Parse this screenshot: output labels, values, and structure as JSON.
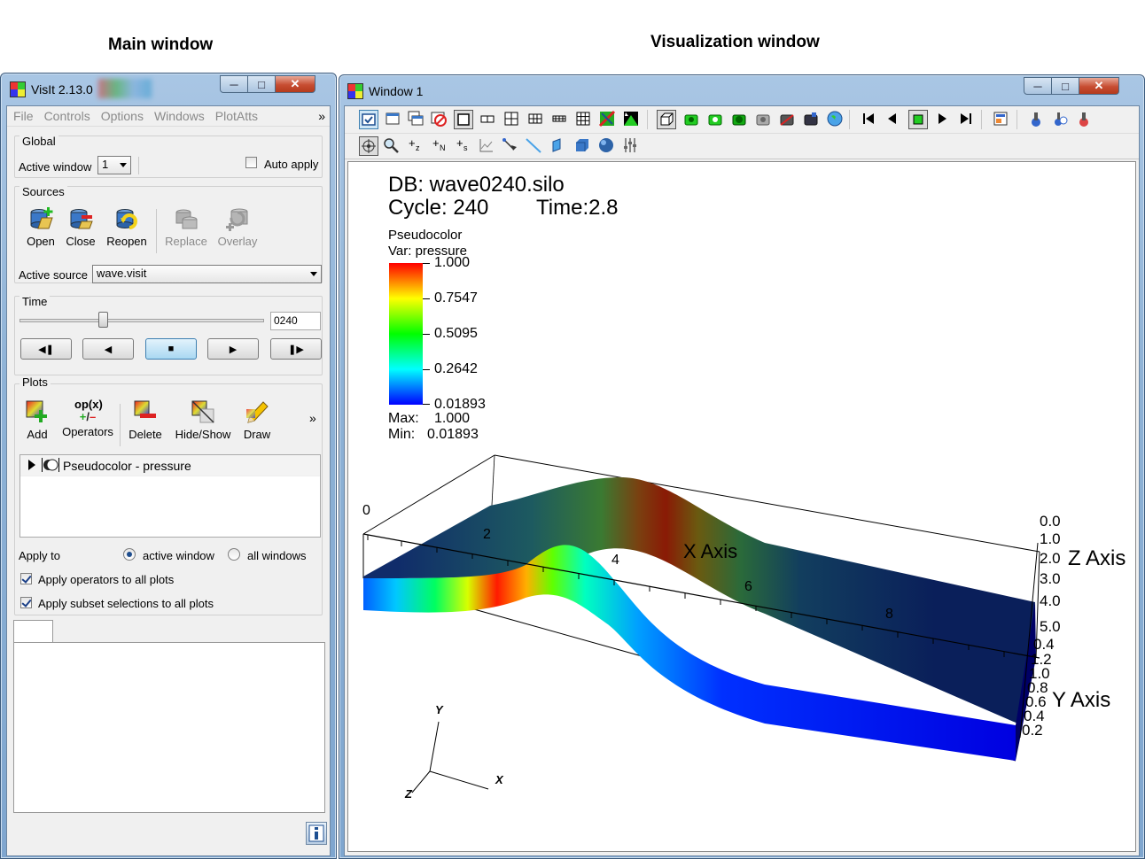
{
  "captions": {
    "main": "Main window",
    "viz": "Visualization window"
  },
  "main_window": {
    "title": "VisIt 2.13.0",
    "menu": [
      "File",
      "Controls",
      "Options",
      "Windows",
      "PlotAtts"
    ],
    "menu_more": "»",
    "global": {
      "title": "Global",
      "active_window_label": "Active window",
      "active_window_value": "1",
      "auto_apply_label": "Auto apply",
      "auto_apply_checked": false
    },
    "sources": {
      "title": "Sources",
      "buttons": [
        "Open",
        "Close",
        "Reopen",
        "Replace",
        "Overlay"
      ],
      "active_source_label": "Active source",
      "active_source_value": "wave.visit"
    },
    "time": {
      "title": "Time",
      "state_value": "0240",
      "slider_fraction": 0.34
    },
    "plots": {
      "title": "Plots",
      "buttons": [
        "Add",
        "Operators",
        "Delete",
        "Hide/Show",
        "Draw"
      ],
      "more": "»",
      "operators_icon_text": "op(x)",
      "plot_list": [
        "Pseudocolor - pressure"
      ],
      "apply_to_label": "Apply to",
      "apply_to_options": [
        "active window",
        "all windows"
      ],
      "apply_to_selected": "active window",
      "apply_operators_label": "Apply operators to all plots",
      "apply_subset_label": "Apply subset selections to all plots"
    },
    "colors": {
      "accent": "#3c7fb1",
      "disabled_text": "#8a8a8a"
    }
  },
  "viz_window": {
    "title": "Window 1",
    "db_line": "DB: wave0240.silo",
    "cycle_line": "Cycle: 240",
    "time_line": "Time:2.8",
    "legend": {
      "plot_type": "Pseudocolor",
      "var_line": "Var: pressure",
      "ticks": [
        "1.000",
        "0.7547",
        "0.5095",
        "0.2642",
        "0.01893"
      ],
      "max_label": "Max:",
      "max_value": "1.000",
      "min_label": "Min:",
      "min_value": "0.01893"
    },
    "axes": {
      "x_title": "X Axis",
      "y_title": "Y Axis",
      "z_title": "Z Axis",
      "x_ticks": [
        "0",
        "2",
        "4",
        "6",
        "8"
      ],
      "z_ticks": [
        "0.0",
        "1.0",
        "2.0",
        "3.0",
        "4.0",
        "5.0"
      ],
      "y_ticks": [
        "0.4",
        "1.2",
        "1.0",
        "0.8",
        "0.6",
        "0.4",
        "0.2"
      ],
      "triad": {
        "x": "X",
        "y": "Y",
        "z": "Z"
      }
    },
    "colormap": [
      "#0000ff",
      "#00ffff",
      "#00ff00",
      "#ffff00",
      "#ff0000"
    ]
  }
}
